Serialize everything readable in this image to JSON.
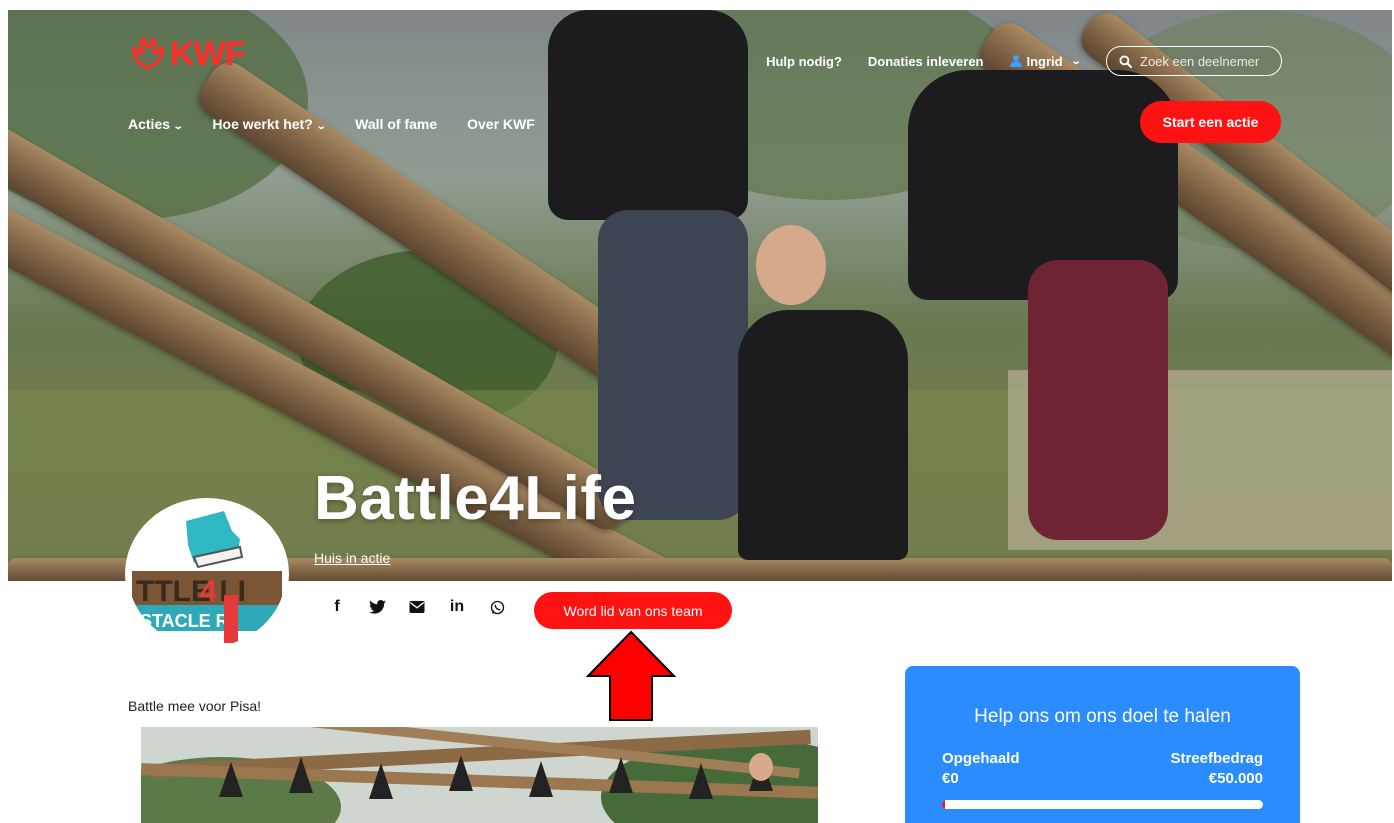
{
  "brand": {
    "logo_text": "KWF",
    "accent": "#ff1212",
    "card_color": "#2a8cff"
  },
  "topnav": {
    "help": "Hulp nodig?",
    "donations": "Donaties inleveren",
    "user": "Ingrid",
    "search_placeholder": "Zoek een deelnemer"
  },
  "mainnav": {
    "items": [
      {
        "label": "Acties",
        "has_dropdown": true
      },
      {
        "label": "Hoe werkt het?",
        "has_dropdown": true
      },
      {
        "label": "Wall of fame",
        "has_dropdown": false
      },
      {
        "label": "Over KWF",
        "has_dropdown": false
      }
    ],
    "cta": "Start een actie"
  },
  "hero": {
    "title": "Battle4Life",
    "subtitle": "Huis in actie"
  },
  "share": {
    "icons": [
      "facebook-icon",
      "twitter-icon",
      "email-icon",
      "linkedin-icon",
      "whatsapp-icon"
    ],
    "join_label": "Word lid van ons team"
  },
  "content": {
    "intro": "Battle mee voor Pisa!"
  },
  "donation_card": {
    "title": "Help ons om ons doel te halen",
    "raised_label": "Opgehaald",
    "raised_value": "€0",
    "goal_label": "Streefbedrag",
    "goal_value": "€50.000",
    "progress_fraction": 0.01
  }
}
